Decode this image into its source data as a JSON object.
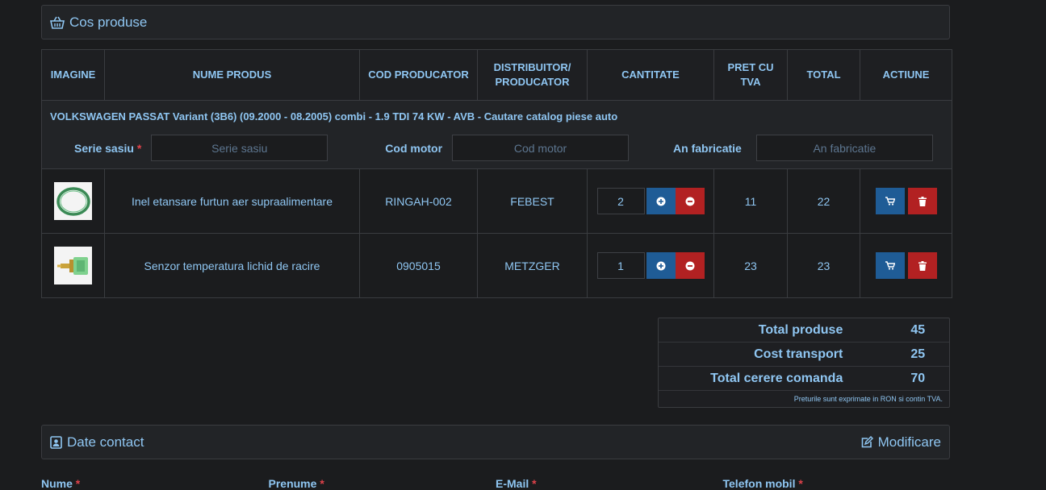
{
  "cart": {
    "title": "Cos produse",
    "columns": [
      "IMAGINE",
      "NUME PRODUS",
      "COD PRODUCATOR",
      "DISTRIBUITOR/ PRODUCATOR",
      "CANTITATE",
      "PRET CU TVA",
      "TOTAL",
      "ACTIUNE"
    ],
    "vehicle": {
      "title": "VOLKSWAGEN PASSAT Variant (3B6) (09.2000 - 08.2005) combi - 1.9 TDI 74 KW - AVB - Cautare catalog piese auto",
      "fields": [
        {
          "label": "Serie sasiu",
          "required": "*",
          "placeholder": "Serie sasiu"
        },
        {
          "label": "Cod motor",
          "required": "",
          "placeholder": "Cod motor"
        },
        {
          "label": "An fabricatie",
          "required": "",
          "placeholder": "An fabricatie"
        }
      ]
    },
    "items": [
      {
        "name": "Inel etansare furtun aer supraalimentare",
        "code": "RINGAH-002",
        "brand": "FEBEST",
        "qty": "2",
        "price": "11",
        "total": "22",
        "image": "o-ring-icon"
      },
      {
        "name": "Senzor temperatura lichid de racire",
        "code": "0905015",
        "brand": "METZGER",
        "qty": "1",
        "price": "23",
        "total": "23",
        "image": "temperature-sensor-icon"
      }
    ]
  },
  "summary": {
    "rows": [
      {
        "label": "Total produse",
        "value": "45"
      },
      {
        "label": "Cost transport",
        "value": "25"
      },
      {
        "label": "Total cerere comanda",
        "value": "70"
      }
    ],
    "note": "Preturile sunt exprimate in RON si contin TVA."
  },
  "contact": {
    "title": "Date contact",
    "edit_label": "Modificare",
    "fields": [
      {
        "label": "Nume",
        "required": "*"
      },
      {
        "label": "Prenume",
        "required": "*"
      },
      {
        "label": "E-Mail",
        "required": "*"
      },
      {
        "label": "Telefon mobil",
        "required": "*"
      }
    ]
  },
  "colors": {
    "accent": "#8fc6f2",
    "blue_button": "#1f5c96",
    "red_button": "#b22122",
    "background": "#1b1c1e"
  }
}
